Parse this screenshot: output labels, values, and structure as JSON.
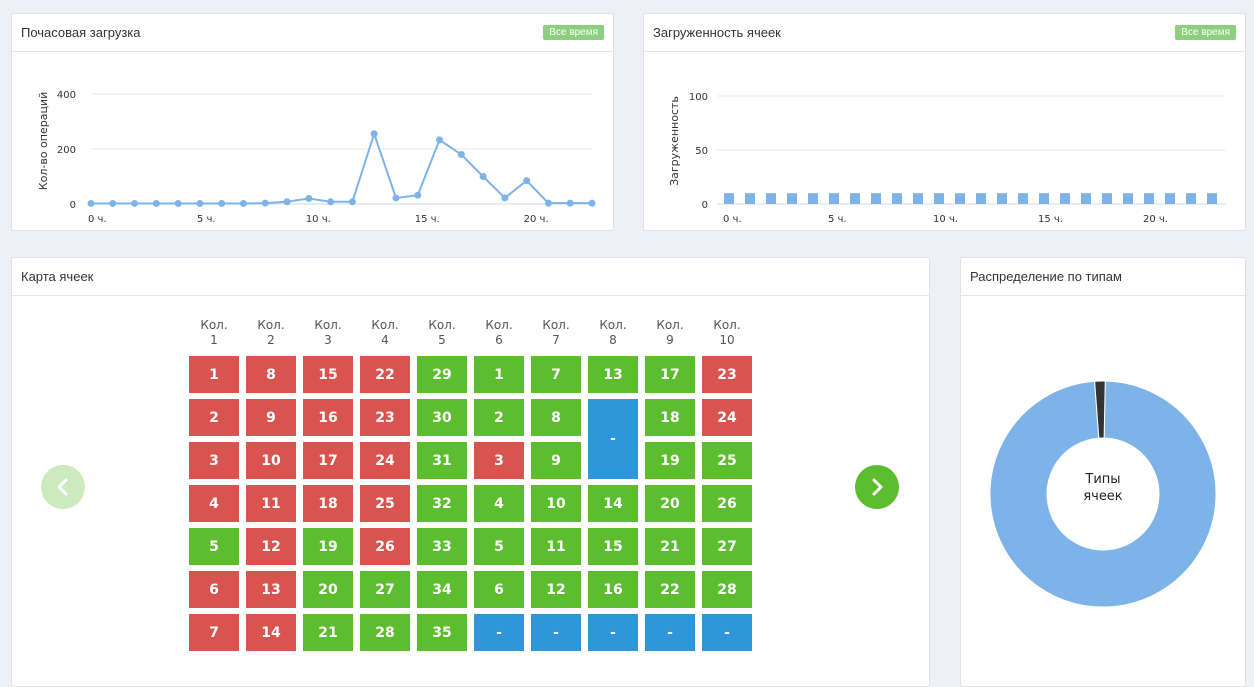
{
  "hourly_panel": {
    "title": "Почасовая загрузка",
    "badge": "Все время",
    "ylabel": "Кол-во операций",
    "y_ticks": [
      "0",
      "200",
      "400"
    ],
    "x_ticks": [
      "0 ч.",
      "5 ч.",
      "10 ч.",
      "15 ч.",
      "20 ч."
    ]
  },
  "load_panel": {
    "title": "Загруженность ячеек",
    "badge": "Все время",
    "ylabel": "Загруженность",
    "y_ticks": [
      "0",
      "50",
      "100"
    ],
    "x_ticks": [
      "0 ч.",
      "5 ч.",
      "10 ч.",
      "15 ч.",
      "20 ч."
    ]
  },
  "map_panel": {
    "title": "Карта ячеек",
    "columns": [
      {
        "line1": "Кол.",
        "line2": "1"
      },
      {
        "line1": "Кол.",
        "line2": "2"
      },
      {
        "line1": "Кол.",
        "line2": "3"
      },
      {
        "line1": "Кол.",
        "line2": "4"
      },
      {
        "line1": "Кол.",
        "line2": "5"
      },
      {
        "line1": "Кол.",
        "line2": "6"
      },
      {
        "line1": "Кол.",
        "line2": "7"
      },
      {
        "line1": "Кол.",
        "line2": "8"
      },
      {
        "line1": "Кол.",
        "line2": "9"
      },
      {
        "line1": "Кол.",
        "line2": "10"
      }
    ],
    "rows": [
      [
        {
          "label": "1",
          "status": "red"
        },
        {
          "label": "8",
          "status": "red"
        },
        {
          "label": "15",
          "status": "red"
        },
        {
          "label": "22",
          "status": "red"
        },
        {
          "label": "29",
          "status": "green"
        },
        {
          "label": "1",
          "status": "green"
        },
        {
          "label": "7",
          "status": "green"
        },
        {
          "label": "13",
          "status": "green"
        },
        {
          "label": "17",
          "status": "green"
        },
        {
          "label": "23",
          "status": "red"
        }
      ],
      [
        {
          "label": "2",
          "status": "red"
        },
        {
          "label": "9",
          "status": "red"
        },
        {
          "label": "16",
          "status": "red"
        },
        {
          "label": "23",
          "status": "red"
        },
        {
          "label": "30",
          "status": "green"
        },
        {
          "label": "2",
          "status": "green"
        },
        {
          "label": "8",
          "status": "green"
        },
        {
          "label": "-",
          "status": "blue",
          "rowspan": 2
        },
        {
          "label": "18",
          "status": "green"
        },
        {
          "label": "24",
          "status": "red"
        }
      ],
      [
        {
          "label": "3",
          "status": "red"
        },
        {
          "label": "10",
          "status": "red"
        },
        {
          "label": "17",
          "status": "red"
        },
        {
          "label": "24",
          "status": "red"
        },
        {
          "label": "31",
          "status": "green"
        },
        {
          "label": "3",
          "status": "red"
        },
        {
          "label": "9",
          "status": "green"
        },
        null,
        {
          "label": "19",
          "status": "green"
        },
        {
          "label": "25",
          "status": "green"
        }
      ],
      [
        {
          "label": "4",
          "status": "red"
        },
        {
          "label": "11",
          "status": "red"
        },
        {
          "label": "18",
          "status": "red"
        },
        {
          "label": "25",
          "status": "red"
        },
        {
          "label": "32",
          "status": "green"
        },
        {
          "label": "4",
          "status": "green"
        },
        {
          "label": "10",
          "status": "green"
        },
        {
          "label": "14",
          "status": "green"
        },
        {
          "label": "20",
          "status": "green"
        },
        {
          "label": "26",
          "status": "green"
        }
      ],
      [
        {
          "label": "5",
          "status": "green"
        },
        {
          "label": "12",
          "status": "red"
        },
        {
          "label": "19",
          "status": "green"
        },
        {
          "label": "26",
          "status": "red"
        },
        {
          "label": "33",
          "status": "green"
        },
        {
          "label": "5",
          "status": "green"
        },
        {
          "label": "11",
          "status": "green"
        },
        {
          "label": "15",
          "status": "green"
        },
        {
          "label": "21",
          "status": "green"
        },
        {
          "label": "27",
          "status": "green"
        }
      ],
      [
        {
          "label": "6",
          "status": "red"
        },
        {
          "label": "13",
          "status": "red"
        },
        {
          "label": "20",
          "status": "green"
        },
        {
          "label": "27",
          "status": "green"
        },
        {
          "label": "34",
          "status": "green"
        },
        {
          "label": "6",
          "status": "green"
        },
        {
          "label": "12",
          "status": "green"
        },
        {
          "label": "16",
          "status": "green"
        },
        {
          "label": "22",
          "status": "green"
        },
        {
          "label": "28",
          "status": "green"
        }
      ],
      [
        {
          "label": "7",
          "status": "red"
        },
        {
          "label": "14",
          "status": "red"
        },
        {
          "label": "21",
          "status": "green"
        },
        {
          "label": "28",
          "status": "green"
        },
        {
          "label": "35",
          "status": "green"
        },
        {
          "label": "-",
          "status": "blue"
        },
        {
          "label": "-",
          "status": "blue"
        },
        {
          "label": "-",
          "status": "blue"
        },
        {
          "label": "-",
          "status": "blue"
        },
        {
          "label": "-",
          "status": "blue"
        }
      ]
    ],
    "prev_icon": "chevron-left-icon",
    "next_icon": "chevron-right-icon"
  },
  "types_panel": {
    "title": "Распределение по типам",
    "center_line1": "Типы",
    "center_line2": "ячеек"
  },
  "colors": {
    "red": "#d9534f",
    "green": "#5cbd2e",
    "blue": "#2f96d9",
    "chart_blue": "#7db3e8",
    "badge_green": "#8ccf7e"
  },
  "chart_data": [
    {
      "type": "line",
      "x": [
        0,
        1,
        2,
        3,
        4,
        5,
        6,
        7,
        8,
        9,
        10,
        11,
        12,
        13,
        14,
        15,
        16,
        17,
        18,
        19,
        20,
        21,
        22,
        23
      ],
      "y": [
        2,
        2,
        2,
        2,
        2,
        2,
        2,
        2,
        3,
        8,
        20,
        8,
        8,
        255,
        22,
        32,
        233,
        180,
        100,
        22,
        85,
        3,
        3,
        3
      ],
      "xlabel": "",
      "ylabel": "Кол-во операций",
      "ylim": [
        0,
        400
      ],
      "grid": true
    },
    {
      "type": "bar",
      "categories": [
        0,
        1,
        2,
        3,
        4,
        5,
        6,
        7,
        8,
        9,
        10,
        11,
        12,
        13,
        14,
        15,
        16,
        17,
        18,
        19,
        20,
        21,
        22,
        23
      ],
      "values": [
        10,
        10,
        10,
        10,
        10,
        10,
        10,
        10,
        10,
        10,
        10,
        10,
        10,
        10,
        10,
        10,
        10,
        10,
        10,
        10,
        10,
        10,
        10,
        10
      ],
      "xlabel": "",
      "ylabel": "Загруженность",
      "ylim": [
        0,
        100
      ],
      "grid": true
    },
    {
      "type": "pie",
      "slices": [
        {
          "value": 98.5,
          "color": "#7db3e8"
        },
        {
          "value": 1.5,
          "color": "#333333"
        }
      ],
      "donut": true
    }
  ]
}
